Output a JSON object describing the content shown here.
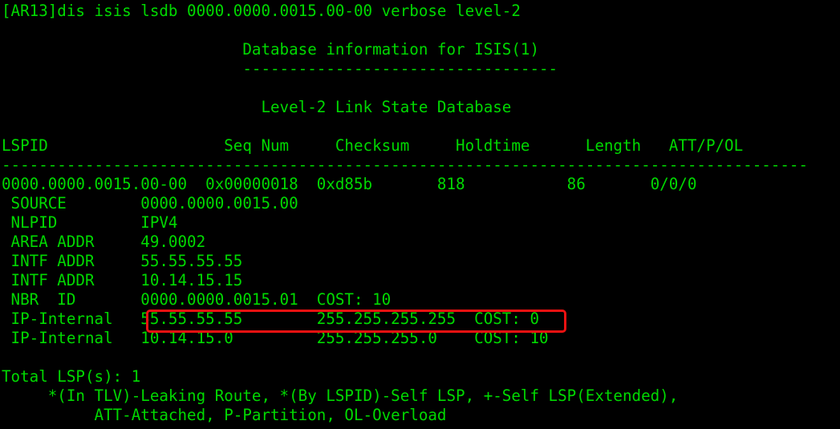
{
  "terminal": {
    "prompt_line": "[AR13]dis isis lsdb 0000.0000.0015.00-00 verbose level-2",
    "blank1": "",
    "db_title": "                          Database information for ISIS(1)",
    "db_title_rule": "                          ----------------------------------",
    "blank2": "",
    "level_title": "                            Level-2 Link State Database",
    "blank3": "",
    "column_header": "LSPID                   Seq Num     Checksum     Holdtime      Length   ATT/P/OL",
    "header_rule": "---------------------------------------------------------------------------------------",
    "lsp_row": "0000.0000.0015.00-00  0x00000018  0xd85b       818           86       0/0/0",
    "tlv_source": " SOURCE        0000.0000.0015.00",
    "tlv_nlpid": " NLPID         IPV4",
    "tlv_area_addr": " AREA ADDR     49.0002",
    "tlv_intf_addr_1": " INTF ADDR     55.55.55.55",
    "tlv_intf_addr_2": " INTF ADDR     10.14.15.15",
    "tlv_nbr_id": " NBR  ID       0000.0000.0015.01  COST: 10",
    "tlv_ip_internal_1": " IP-Internal   55.55.55.55        255.255.255.255  COST: 0",
    "tlv_ip_internal_2": " IP-Internal   10.14.15.0         255.255.255.0    COST: 10",
    "blank4": "",
    "total_lsp": "Total LSP(s): 1",
    "legend_line_1": "     *(In TLV)-Leaking Route, *(By LSPID)-Self LSP, +-Self LSP(Extended),",
    "legend_line_2": "          ATT-Attached, P-Partition, OL-Overload"
  },
  "columns": {
    "lspid": "LSPID",
    "seq_num": "Seq Num",
    "checksum": "Checksum",
    "holdtime": "Holdtime",
    "length": "Length",
    "att_p_ol": "ATT/P/OL"
  },
  "lsp_entry": {
    "lspid": "0000.0000.0015.00-00",
    "seq_num": "0x00000018",
    "checksum": "0xd85b",
    "holdtime": "818",
    "length": "86",
    "att_p_ol": "0/0/0"
  },
  "highlight": {
    "label": "IP-Internal",
    "prefix": "55.55.55.55",
    "mask": "255.255.255.255",
    "cost": "COST: 0",
    "color": "#ee1111"
  },
  "colors": {
    "background": "#000000",
    "text": "#00d900",
    "highlight_border": "#ee1111"
  }
}
